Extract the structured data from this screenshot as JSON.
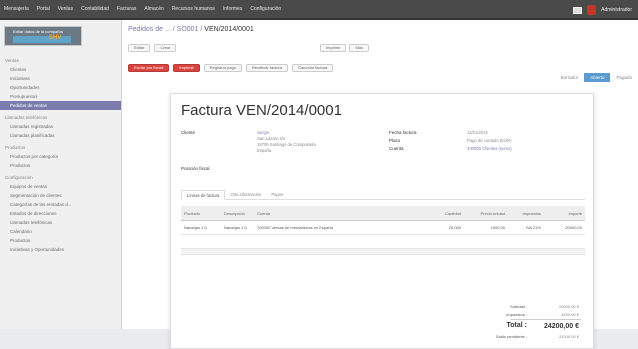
{
  "topbar": {
    "menu": [
      "Mensajería",
      "Portal",
      "Ventas",
      "Contabilidad",
      "Facturas",
      "Almacén",
      "Recursos humanos",
      "Informes",
      "Configuración"
    ],
    "user": "Administrador"
  },
  "sidebar": {
    "logo_text": "Editar datos de la compañía",
    "logo_badge": "SHV",
    "items": [
      {
        "label": "Ventas",
        "head": true
      },
      {
        "label": "Clientes"
      },
      {
        "label": "Iniciativas"
      },
      {
        "label": "Oportunidades"
      },
      {
        "label": "Presupuestos"
      },
      {
        "label": "Pedidos de ventas",
        "active": true
      },
      {
        "label": "Llamadas telefónicas",
        "head": true
      },
      {
        "label": "Llamadas registradas"
      },
      {
        "label": "Llamadas planificadas"
      },
      {
        "label": "Productos",
        "head": true
      },
      {
        "label": "Productos por categoría"
      },
      {
        "label": "Productos"
      },
      {
        "label": "Configuración",
        "head": true
      },
      {
        "label": "Equipos de ventas"
      },
      {
        "label": "Segmentación de clientes"
      },
      {
        "label": "Categorías de las entradas d..."
      },
      {
        "label": "Estados de direcciones"
      },
      {
        "label": "Llamadas telefónicas"
      },
      {
        "label": "Calendario"
      },
      {
        "label": "Productos"
      },
      {
        "label": "Iniciativas y Oportunidades"
      }
    ]
  },
  "breadcrumb": {
    "parent": "Pedidos de ...",
    "mid": "SO001",
    "current": "VEN/2014/0001"
  },
  "buttons": {
    "edit": "Editar",
    "create": "Crear",
    "print": "Imprimir",
    "more": "Más",
    "send_email": "Enviar por Email",
    "print_red": "Imprimir",
    "register_payment": "Registrar pago",
    "refund": "Rectificar factura",
    "cancel_invoice": "Cancelar factura"
  },
  "steps": [
    "Borrador",
    "Abierto",
    "Pagado"
  ],
  "invoice": {
    "title": "Factura VEN/2014/0001",
    "customer_label": "Cliente",
    "customer_lines": [
      "Sergio",
      "San Lázaro s/n",
      "15706 Santiago de Compostela",
      "España"
    ],
    "fiscal_label": "Posición fiscal",
    "date_label": "Fecha factura",
    "date_value": "11/01/2014",
    "term_label": "Plazo",
    "term_value": "Pago de contado (EUR)",
    "account_label": "Cuenta",
    "account_value": "430000 Clientes (euros)"
  },
  "tabs": [
    "Líneas de factura",
    "Otra información",
    "Pagos"
  ],
  "table": {
    "headers": [
      "Producto",
      "Descripción",
      "Cuenta",
      "Cantidad",
      "Precio unidad",
      "Impuestos",
      "Importe"
    ],
    "rows": [
      [
        "Naranjas 1.0",
        "Naranjas 1.0",
        "700000 Ventas de mercaderías en España",
        "20.000",
        "1000.00",
        "IVA 21%",
        "20000.00"
      ]
    ]
  },
  "totals": {
    "subtotal_label": "Subtotal :",
    "subtotal_value": "20000,00 €",
    "tax_label": "Impuestos :",
    "tax_value": "4200,00 €",
    "total_label": "Total :",
    "total_value": "24200,00 €",
    "due_label": "Saldo pendiente :",
    "due_value": "24200,00 €"
  }
}
